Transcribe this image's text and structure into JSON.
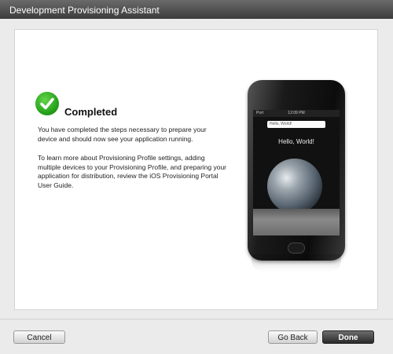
{
  "window": {
    "title": "Development Provisioning Assistant"
  },
  "content": {
    "status_title": "Completed",
    "paragraph1": "You have completed the steps necessary to prepare your device and should now see your application running.",
    "paragraph2": "To learn more about Provisioning Profile settings, adding multiple devices to your Provisioning Profile, and preparing your application for distribution, review the iOS Provisioning Portal User Guide."
  },
  "phone": {
    "carrier": "Port",
    "time": "12:09 PM",
    "textfield_value": "Hello, World!",
    "hello_label": "Hello, World!"
  },
  "buttons": {
    "cancel": "Cancel",
    "go_back": "Go Back",
    "done": "Done"
  },
  "icons": {
    "status": "checkmark-icon"
  },
  "colors": {
    "success_green": "#22a11a",
    "done_button": "#3a3a3a"
  }
}
